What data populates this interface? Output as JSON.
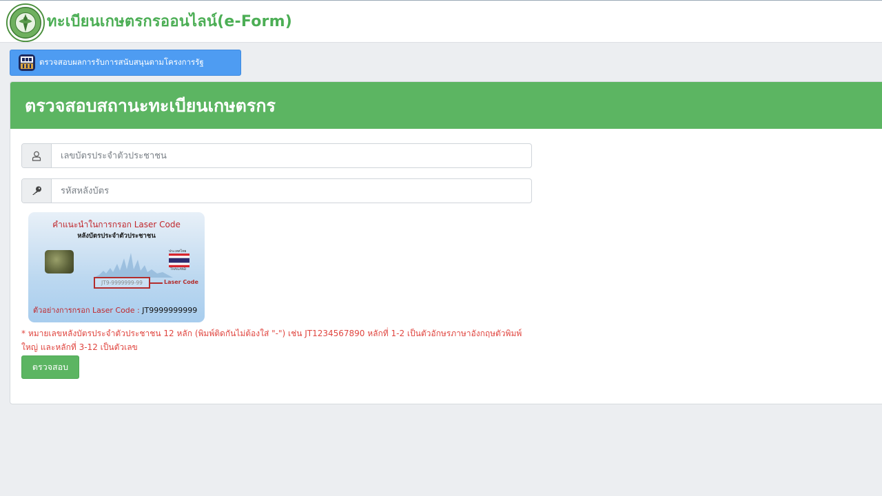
{
  "header": {
    "title": "ทะเบียนเกษตรกรออนไลน์(e-Form)",
    "logo_icon": "ministry-seal-icon"
  },
  "support_button": {
    "label": "ตรวจสอบผลการรับการสนับสนุนตามโครงการรัฐ",
    "icon": "government-building-icon"
  },
  "panel": {
    "title": "ตรวจสอบสถานะทะเบียนเกษตรกร",
    "id_field": {
      "placeholder": "เลขบัตรประจำตัวประชาชน",
      "icon": "user-icon"
    },
    "laser_field": {
      "placeholder": "รหัสหลังบัตร",
      "icon": "key-icon"
    },
    "card": {
      "line1": "คำแนะนำในการกรอก Laser Code",
      "line2": "หลังบัตรประจำตัวประชาชน",
      "flag_label": "ประเทศไทย",
      "flag_country": "THAILAND",
      "sample_code": "JT9-9999999-99",
      "pointer_label": "Laser Code",
      "example_label": "ตัวอย่างการกรอก Laser Code :",
      "example_value": "JT9999999999"
    },
    "note": "* หมายเลขหลังบัตรประจำตัวประชาชน 12 หลัก (พิมพ์ติดกันไม่ต้องใส่ \"-\") เช่น JT1234567890 หลักที่ 1-2 เป็นตัวอักษรภาษาอังกฤษตัวพิมพ์ใหญ่ และหลักที่ 3-12 เป็นตัวเลข",
    "submit_label": "ตรวจสอบ"
  },
  "colors": {
    "brand_green": "#5cb562",
    "title_green": "#4cae55",
    "button_blue": "#4e9cf2",
    "note_red": "#e0453f"
  }
}
